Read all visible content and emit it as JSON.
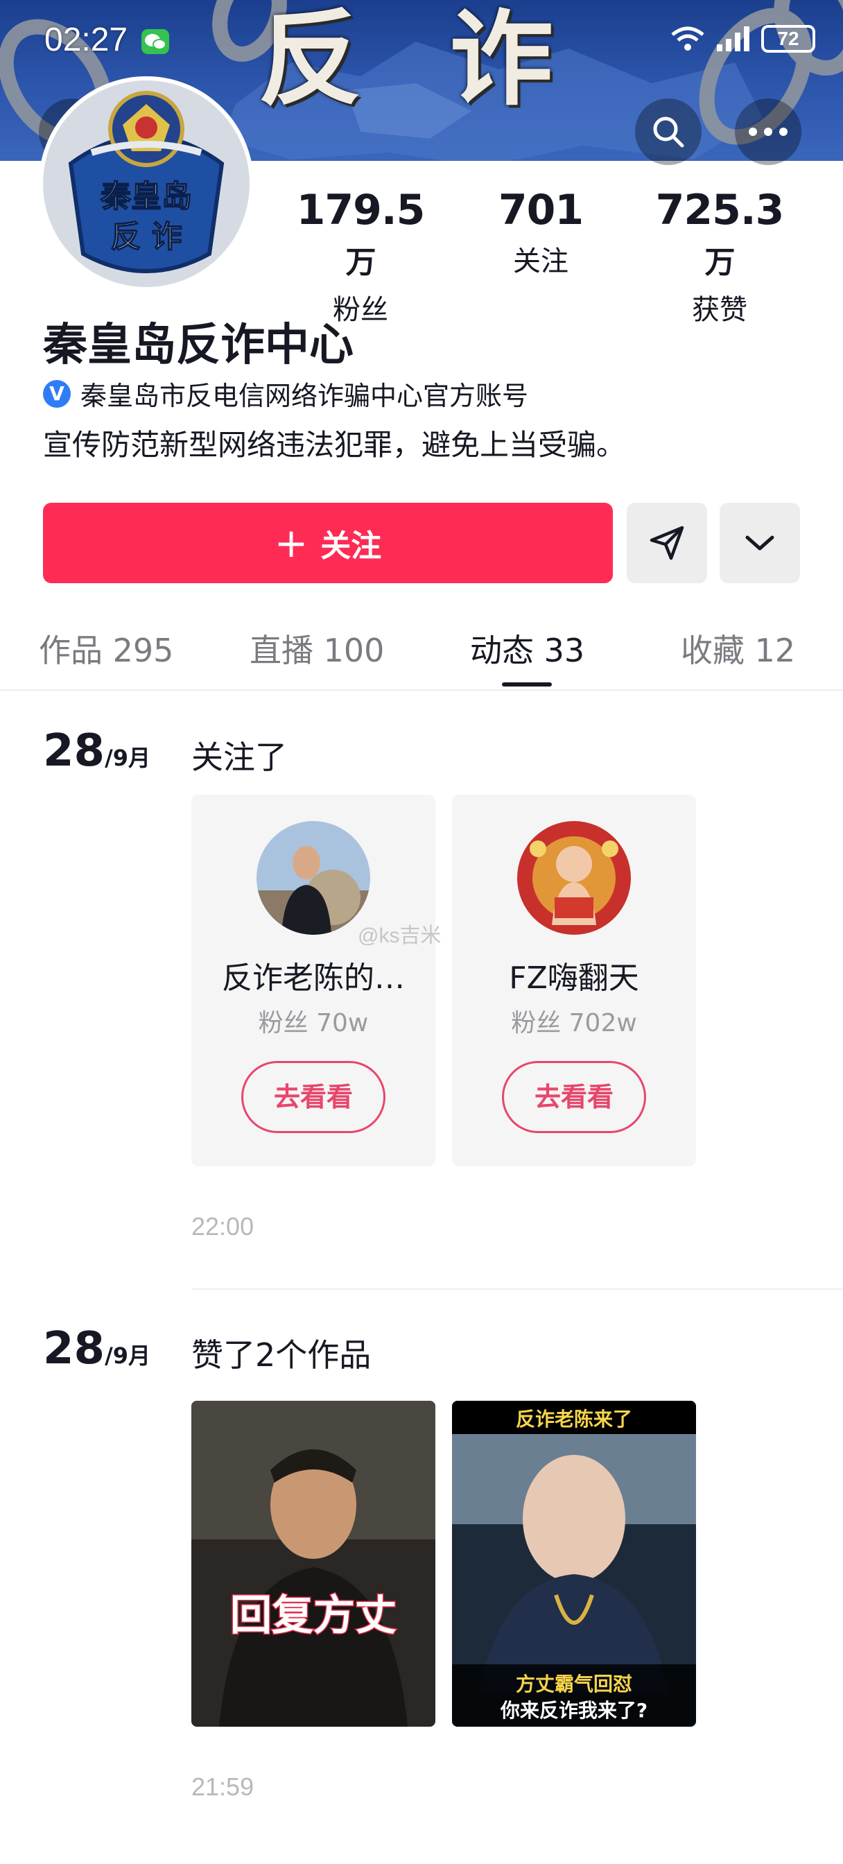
{
  "status_bar": {
    "time": "02:27",
    "battery": "72"
  },
  "banner": {
    "char1": "反",
    "char2": "诈"
  },
  "avatar": {
    "line1": "秦皇岛",
    "line2": "反 诈"
  },
  "stats": [
    {
      "value": "179.5",
      "unit": "万",
      "label": "粉丝"
    },
    {
      "value": "701",
      "unit": "",
      "label": "关注"
    },
    {
      "value": "725.3",
      "unit": "万",
      "label": "获赞"
    }
  ],
  "profile": {
    "name": "秦皇岛反诈中心",
    "verify_badge": "V",
    "verified_text": "秦皇岛市反电信网络诈骗中心官方账号",
    "bio": "宣传防范新型网络违法犯罪，避免上当受骗。"
  },
  "actions": {
    "follow_label": "关注",
    "follow_plus": "+"
  },
  "tabs": [
    {
      "label": "作品 295"
    },
    {
      "label": "直播 100"
    },
    {
      "label": "动态 33"
    },
    {
      "label": "收藏 12"
    }
  ],
  "feed": [
    {
      "day": "28",
      "month": "/9月",
      "action": "关注了",
      "time": "22:00",
      "cards": [
        {
          "name": "反诈老陈的…",
          "fans": "粉丝 70w",
          "button": "去看看"
        },
        {
          "name": "FZ嗨翻天",
          "fans": "粉丝 702w",
          "button": "去看看"
        }
      ]
    },
    {
      "day": "28",
      "month": "/9月",
      "action": "赞了2个作品",
      "time": "21:59",
      "thumbs": [
        {
          "caption": "回复方丈"
        },
        {
          "top_caption": "反诈老陈来了",
          "bottom_line1": "方丈霸气回怼",
          "bottom_line2": "你来反诈我来了?"
        }
      ]
    }
  ],
  "watermark": "@ks吉米",
  "colors": {
    "accent": "#fe2c55",
    "verify_blue": "#2f7cf6",
    "pill_pink": "#e8466c"
  }
}
